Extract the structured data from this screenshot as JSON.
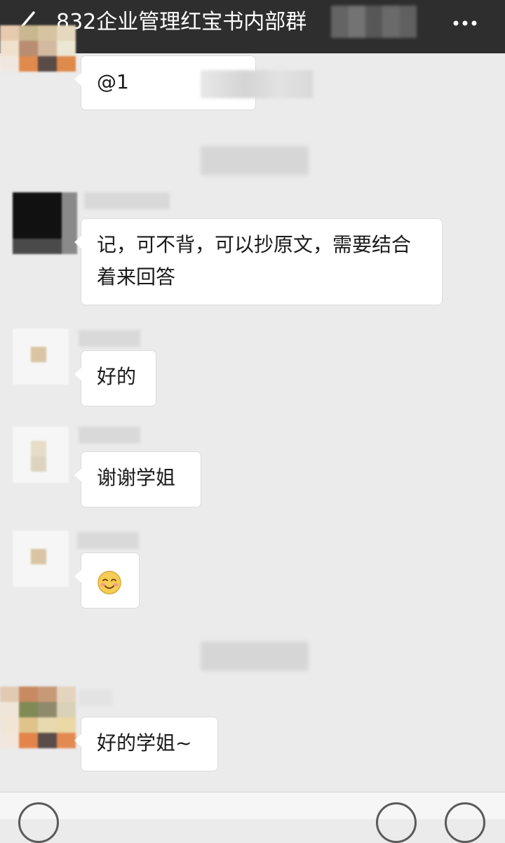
{
  "header": {
    "title": "832企业管理红宝书内部群"
  },
  "messages": [
    {
      "type": "text",
      "text": "@1"
    },
    {
      "type": "text",
      "text": "记，可不背，可以抄原文，需要结合着来回答"
    },
    {
      "type": "text",
      "text": "好的"
    },
    {
      "type": "text",
      "text": "谢谢学姐"
    },
    {
      "type": "emoji",
      "icon": "smiley-icon"
    },
    {
      "type": "text",
      "text": "好的学姐~"
    }
  ],
  "colors": {
    "header_bg": "#2e2e2e",
    "chat_bg": "#ebebeb",
    "bubble_bg": "#ffffff"
  }
}
